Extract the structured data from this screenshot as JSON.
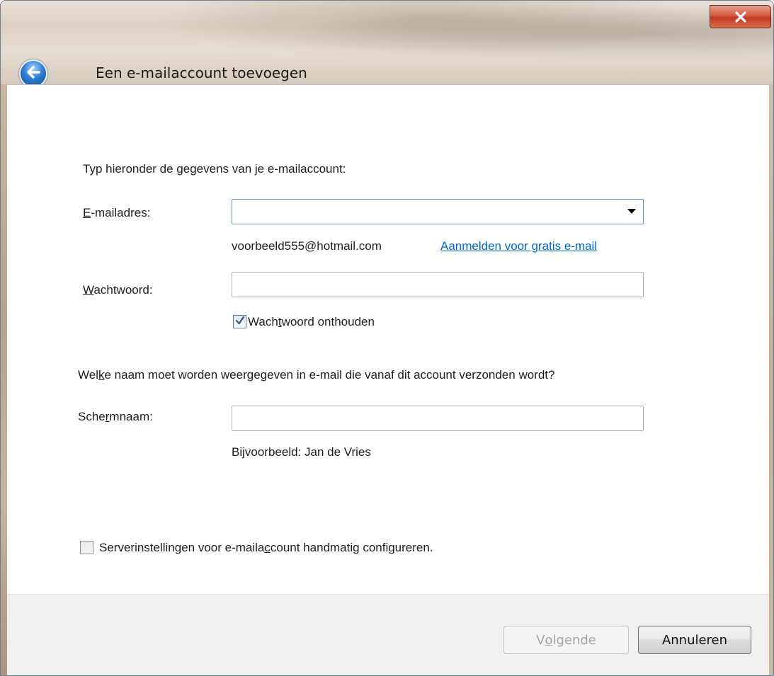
{
  "window": {
    "title": "Een e-mailaccount toevoegen"
  },
  "form": {
    "intro": "Typ hieronder de gegevens van je e-mailaccount:",
    "email": {
      "label_key": "E",
      "label_rest": "-mailadres:",
      "value": "",
      "example": "voorbeeld555@hotmail.com",
      "signup_link": "Aanmelden voor gratis e-mail"
    },
    "password": {
      "label_key": "W",
      "label_rest": "achtwoord:",
      "value": ""
    },
    "remember": {
      "label_pre": "Wach",
      "label_key": "t",
      "label_post": "woord onthouden",
      "checked": true
    },
    "display_question": {
      "pre": "Wel",
      "key": "k",
      "post": "e naam moet worden weergegeven in e-mail die vanaf dit account verzonden wordt?"
    },
    "display_name": {
      "label_pre": "Sche",
      "label_key": "r",
      "label_post": "mnaam:",
      "value": "",
      "example": "Bijvoorbeeld: Jan de Vries"
    },
    "manual_config": {
      "label_pre": "Serverinstellingen voor e-maila",
      "label_key": "c",
      "label_post": "count handmatig configureren.",
      "checked": false
    }
  },
  "footer": {
    "next": {
      "pre": "V",
      "key": "o",
      "post": "lgende"
    },
    "cancel": "Annuleren"
  },
  "colors": {
    "link": "#0066cc",
    "close_button": "#c23b22",
    "back_button": "#2d7fd0"
  },
  "icons": [
    "close-icon",
    "back-arrow-icon",
    "checkmark-icon",
    "dropdown-arrow-icon"
  ]
}
